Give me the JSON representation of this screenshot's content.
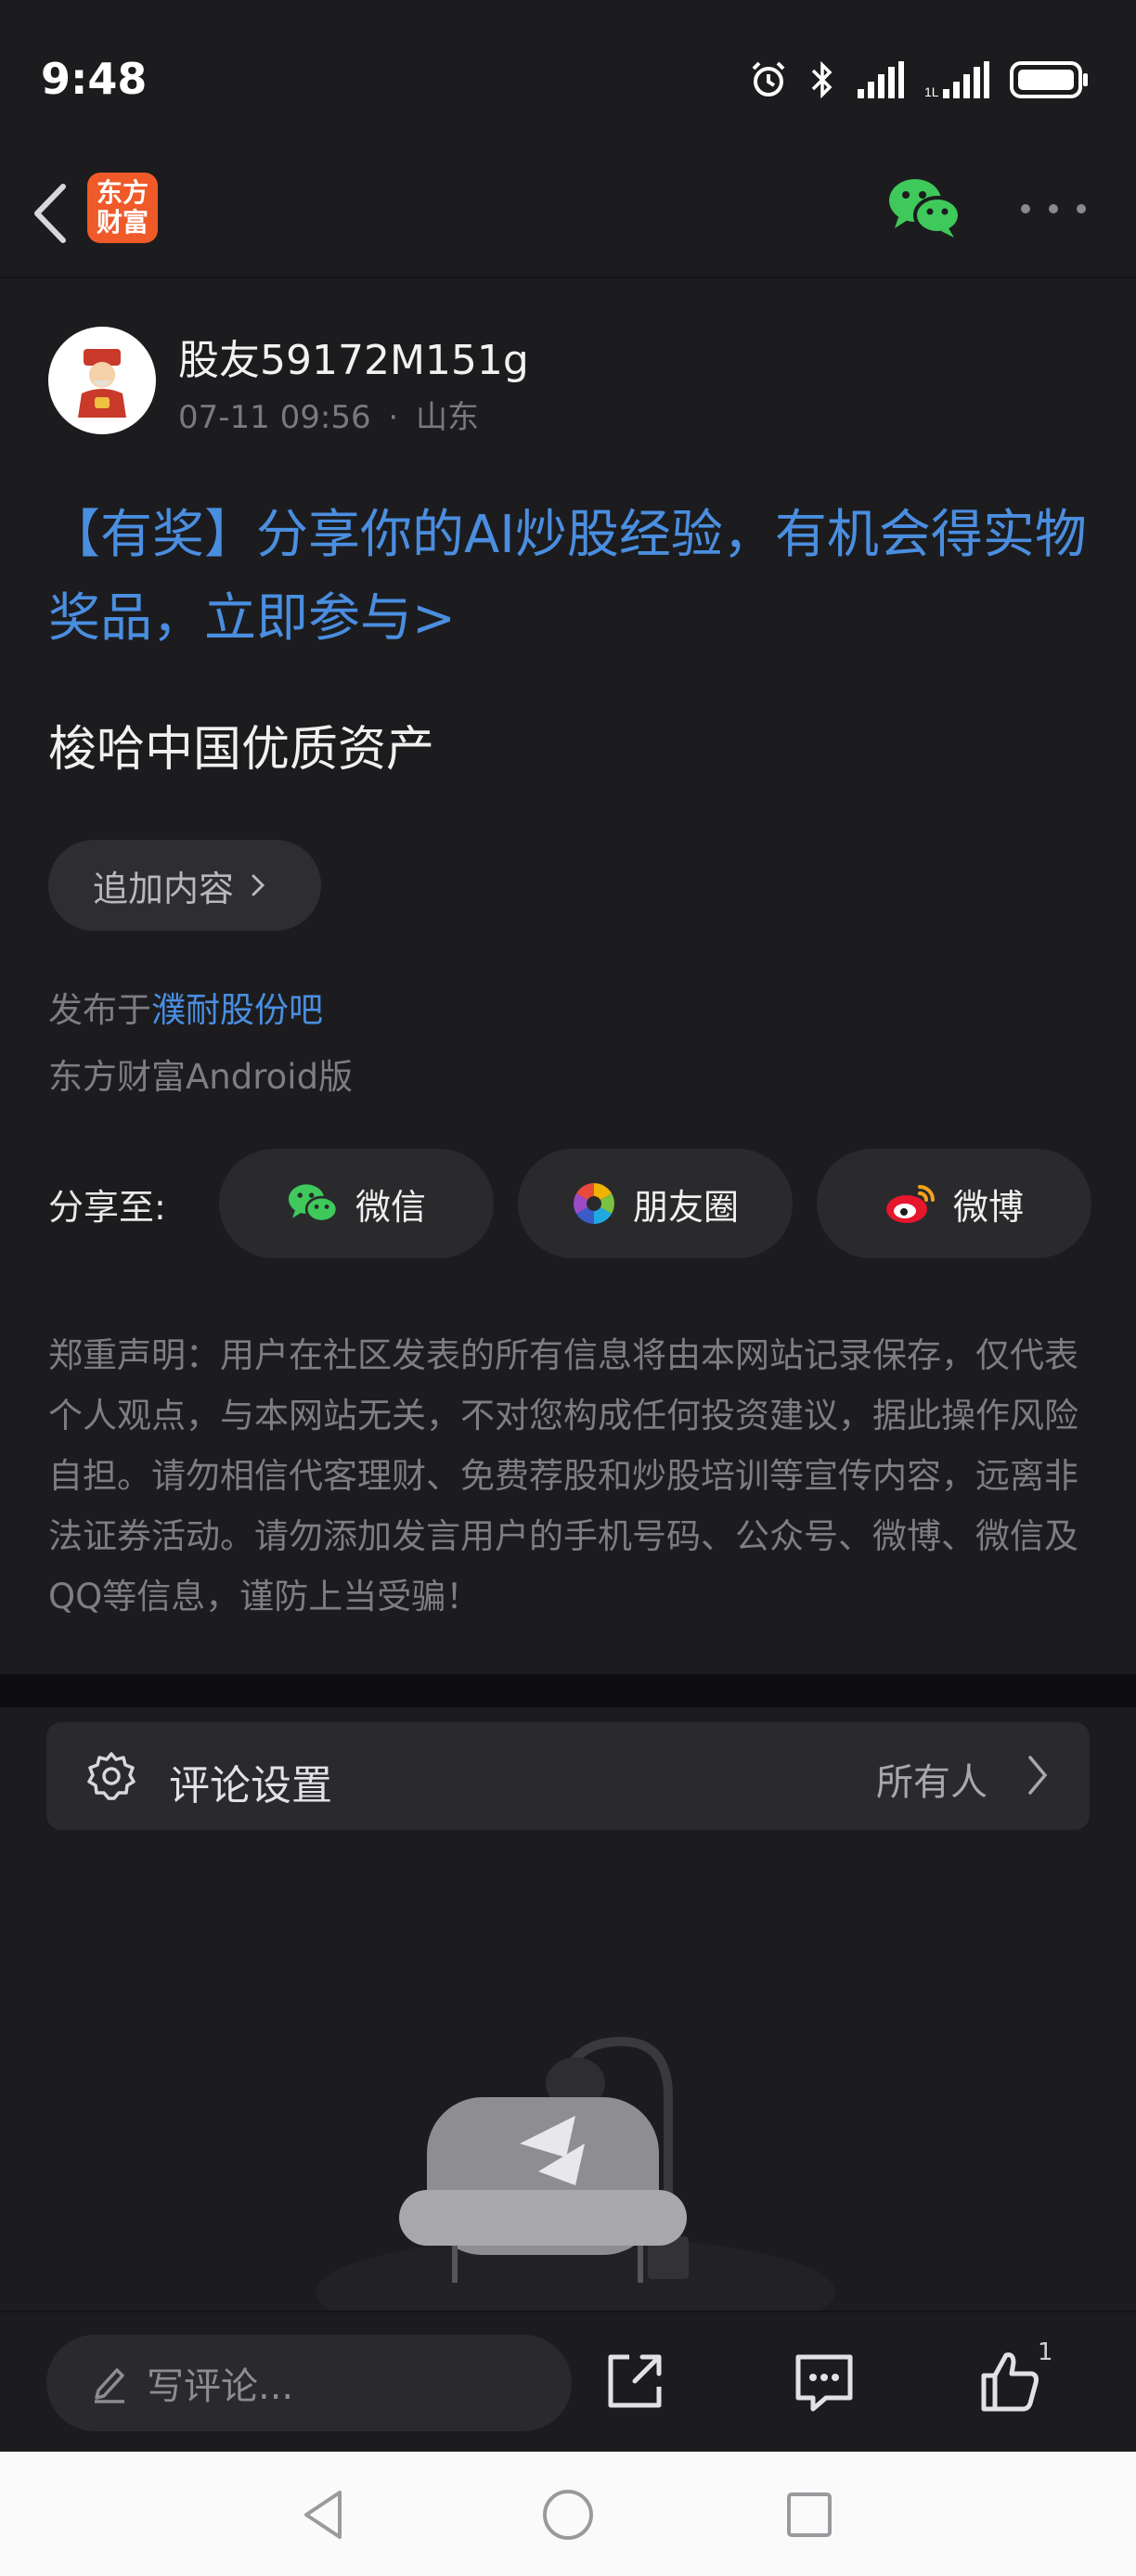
{
  "status_bar": {
    "time": "9:48",
    "icons": [
      "alarm-icon",
      "bluetooth-icon",
      "signal-icon",
      "signal-icon",
      "battery-icon"
    ]
  },
  "nav": {
    "back_icon": "chevron-left-icon",
    "app_logo_line1": "东方",
    "app_logo_line2": "财富",
    "wechat_icon": "wechat-icon",
    "more_icon": "more-dots-icon",
    "logo_color": "#ef5a28"
  },
  "post": {
    "author": "股友59172M151g",
    "date": "07-11 09:56",
    "separator": "·",
    "location": "山东",
    "promo_text": "【有奖】分享你的AI炒股经验，有机会得实物奖品，立即参与>",
    "body": "梭哈中国优质资产",
    "add_content_label": "追加内容",
    "publish_prefix": "发布于",
    "forum_name": "濮耐股份吧",
    "client_info": "东方财富Android版",
    "link_color": "#4a8ee0"
  },
  "share": {
    "label": "分享至:",
    "buttons": [
      {
        "label": "微信",
        "icon": "wechat-icon"
      },
      {
        "label": "朋友圈",
        "icon": "moments-icon"
      },
      {
        "label": "微博",
        "icon": "weibo-icon"
      }
    ]
  },
  "disclaimer": "郑重声明：用户在社区发表的所有信息将由本网站记录保存，仅代表个人观点，与本网站无关，不对您构成任何投资建议，据此操作风险自担。请勿相信代客理财、免费荐股和炒股培训等宣传内容，远离非法证券活动。请勿添加发言用户的手机号码、公众号、微博、微信及QQ等信息，谨防上当受骗！",
  "comment_settings": {
    "label": "评论设置",
    "value": "所有人",
    "icon": "gear-icon"
  },
  "bottom_bar": {
    "input_placeholder": "写评论...",
    "input_icon": "pencil-icon",
    "share_icon": "share-icon",
    "comment_icon": "comment-icon",
    "like_icon": "thumbs-up-icon",
    "like_count": "1"
  },
  "system_nav": {
    "back_icon": "triangle-back-icon",
    "home_icon": "circle-home-icon",
    "recent_icon": "square-recent-icon"
  }
}
